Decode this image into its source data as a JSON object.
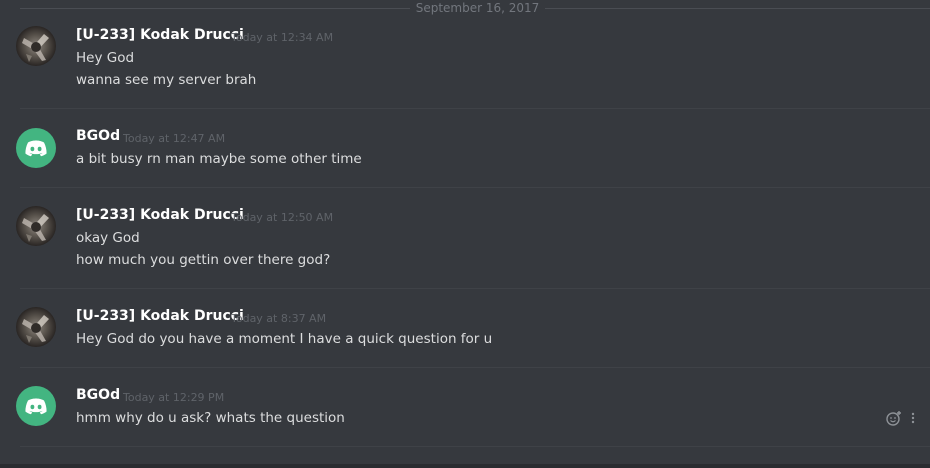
{
  "date_divider": "September 16, 2017",
  "messages": [
    {
      "username": "[U-233] Kodak Drucci",
      "timestamp": "Today at 12:34 AM",
      "avatar": "kodak-avatar",
      "lines": [
        "Hey God",
        "wanna see my server brah"
      ]
    },
    {
      "username": "BGOd",
      "timestamp": "Today at 12:47 AM",
      "avatar": "discord-default-avatar",
      "lines": [
        "a bit busy rn man maybe some other time"
      ]
    },
    {
      "username": "[U-233] Kodak Drucci",
      "timestamp": "Today at 12:50 AM",
      "avatar": "kodak-avatar",
      "lines": [
        "okay God",
        "how much you gettin over there god?"
      ]
    },
    {
      "username": "[U-233] Kodak Drucci",
      "timestamp": "Today at 8:37 AM",
      "avatar": "kodak-avatar",
      "lines": [
        "Hey God do you have a moment I have a quick question for u"
      ]
    },
    {
      "username": "BGOd",
      "timestamp": "Today at 12:29 PM",
      "avatar": "discord-default-avatar",
      "lines": [
        "hmm why do u ask? whats the question"
      ]
    }
  ],
  "hover_actions": {
    "icons": [
      "add-reaction-icon",
      "more-options-icon"
    ]
  },
  "colors": {
    "background": "#36393e",
    "discord_avatar": "#43b581",
    "username": "#ffffff",
    "message_text": "#dcddde",
    "timestamp": "#5f6369"
  }
}
